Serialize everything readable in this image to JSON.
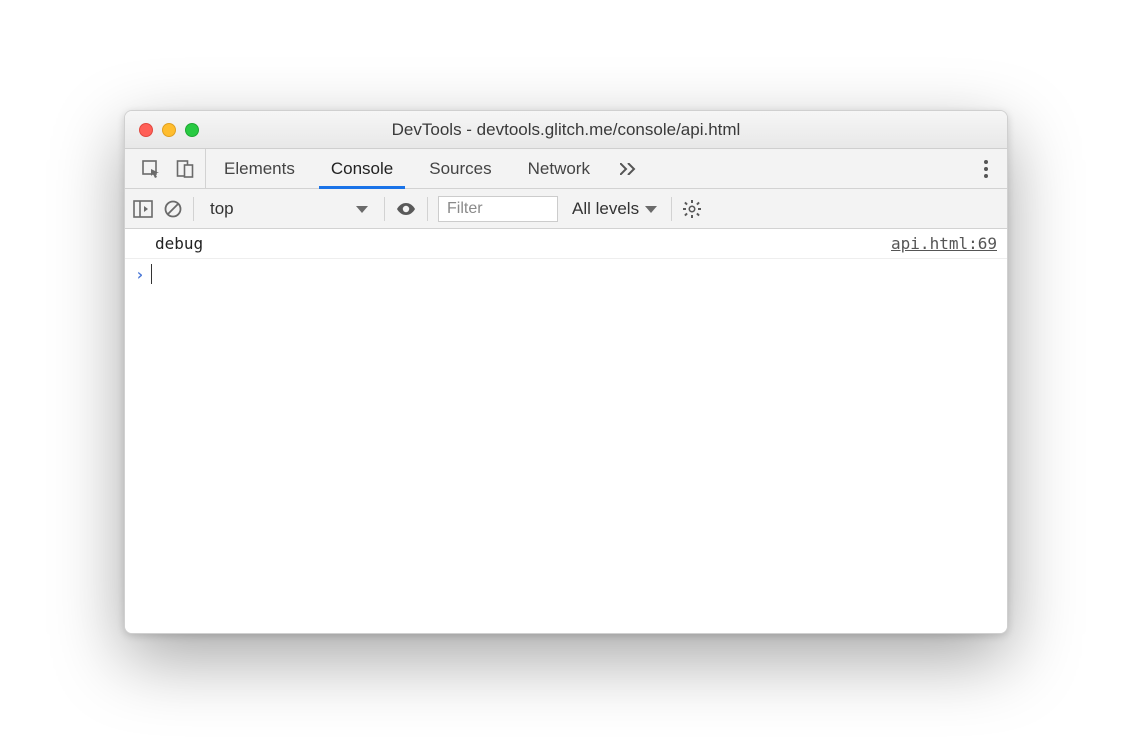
{
  "window": {
    "title": "DevTools - devtools.glitch.me/console/api.html"
  },
  "tabs": {
    "elements": "Elements",
    "console": "Console",
    "sources": "Sources",
    "network": "Network"
  },
  "subtoolbar": {
    "context": "top",
    "filter_placeholder": "Filter",
    "levels": "All levels"
  },
  "console": {
    "logs": [
      {
        "message": "debug",
        "source": "api.html:69"
      }
    ]
  }
}
